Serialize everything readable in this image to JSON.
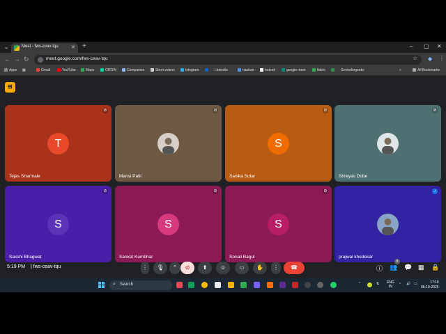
{
  "browser": {
    "tab_title": "Meet - fws-ceav-tqu",
    "url": "meet.google.com/fws-ceav-tqu",
    "bookmarks": [
      "Apps",
      "Gmail",
      "YouTube",
      "Maps",
      "GROW",
      "Companies",
      "Short videos",
      "telegram",
      "Linkedin",
      "naukari",
      "Indeed",
      "google meet",
      "fidelo",
      "Geeksforgeeks"
    ],
    "all_bookmarks": "All Bookmarks"
  },
  "participants": [
    {
      "name": "Tejas Sharmale",
      "initial": "T",
      "tile_color": "#a9321b",
      "avatar_color": "#e8492b",
      "muted": true
    },
    {
      "name": "Mansi Patil",
      "initial": "",
      "tile_color": "#6e5a44",
      "avatar_color": "#d8d0c8",
      "muted": true,
      "photo": true
    },
    {
      "name": "Sanika Sutar",
      "initial": "S",
      "tile_color": "#b85c13",
      "avatar_color": "#ef6c00",
      "muted": true
    },
    {
      "name": "Shreyas Dube",
      "initial": "",
      "tile_color": "#4f7070",
      "avatar_color": "#dfe6ea",
      "muted": true,
      "photo": true
    },
    {
      "name": "Sakshi Bhagwat",
      "initial": "S",
      "tile_color": "#4a1fa8",
      "avatar_color": "#5a33b8",
      "muted": true
    },
    {
      "name": "Sanket Kumbhar",
      "initial": "S",
      "tile_color": "#8c1a55",
      "avatar_color": "#d63a7d",
      "muted": true
    },
    {
      "name": "Sonali Bagul",
      "initial": "S",
      "tile_color": "#8c1a55",
      "avatar_color": "#b81e66",
      "muted": true
    },
    {
      "name": "prajwal khedekar",
      "initial": "",
      "tile_color": "#3322a3",
      "avatar_color": "#8aa4c8",
      "muted": false,
      "photo": true
    }
  ],
  "bottombar": {
    "time": "5:19 PM",
    "separator": "|",
    "meeting_code": "fws-ceav-tqu",
    "people_count": "8"
  },
  "taskbar": {
    "search_placeholder": "Search",
    "lang_top": "ENG",
    "lang_bottom": "IN",
    "clock_time": "17:19",
    "clock_date": "06-10-2025"
  }
}
